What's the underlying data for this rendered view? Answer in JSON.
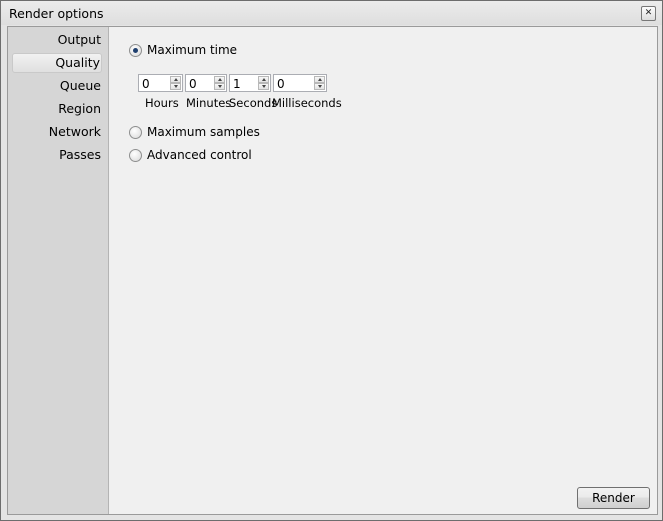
{
  "window": {
    "title": "Render options"
  },
  "nav": [
    {
      "label": "Output"
    },
    {
      "label": "Quality"
    },
    {
      "label": "Queue"
    },
    {
      "label": "Region"
    },
    {
      "label": "Network"
    },
    {
      "label": "Passes"
    }
  ],
  "active_nav": "Quality",
  "quality": {
    "max_time": {
      "label": "Maximum time",
      "selected": true
    },
    "spinners": [
      {
        "value": "0",
        "label": "Hours"
      },
      {
        "value": "0",
        "label": "Minutes"
      },
      {
        "value": "1",
        "label": "Seconds"
      },
      {
        "value": "0",
        "label": "Milliseconds"
      }
    ],
    "max_samples": {
      "label": "Maximum samples",
      "selected": false
    },
    "advanced": {
      "label": "Advanced control",
      "selected": false
    }
  },
  "render_button": "Render"
}
